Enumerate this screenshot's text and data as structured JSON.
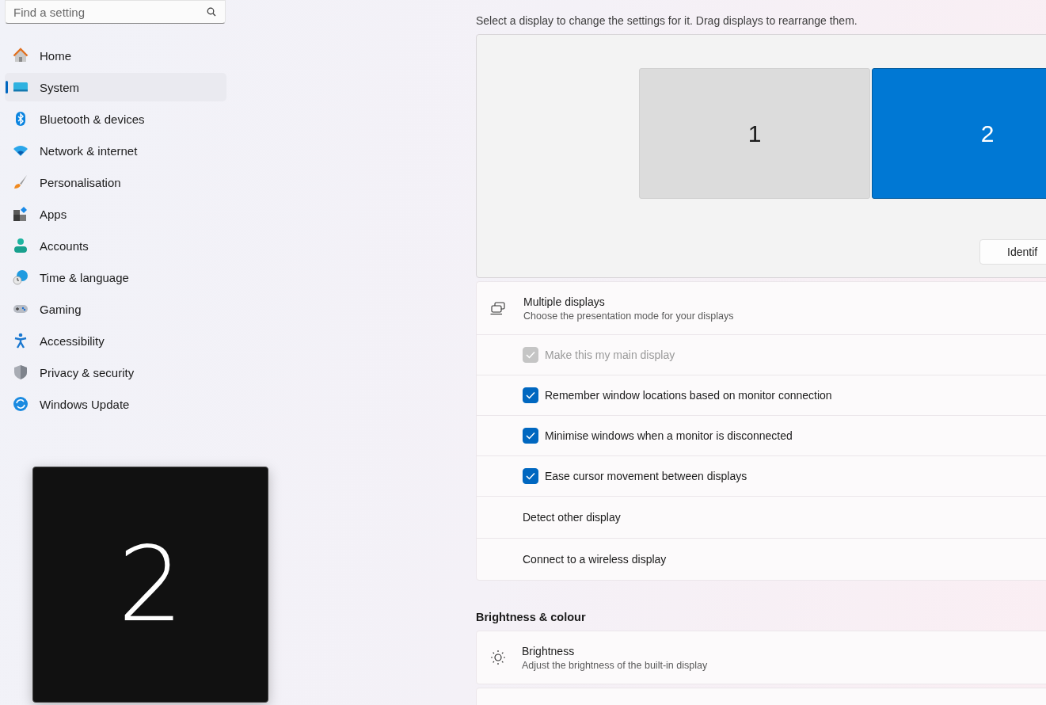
{
  "search": {
    "placeholder": "Find a setting"
  },
  "sidebar": {
    "items": [
      {
        "label": "Home",
        "selected": false
      },
      {
        "label": "System",
        "selected": true
      },
      {
        "label": "Bluetooth & devices",
        "selected": false
      },
      {
        "label": "Network & internet",
        "selected": false
      },
      {
        "label": "Personalisation",
        "selected": false
      },
      {
        "label": "Apps",
        "selected": false
      },
      {
        "label": "Accounts",
        "selected": false
      },
      {
        "label": "Time & language",
        "selected": false
      },
      {
        "label": "Gaming",
        "selected": false
      },
      {
        "label": "Accessibility",
        "selected": false
      },
      {
        "label": "Privacy & security",
        "selected": false
      },
      {
        "label": "Windows Update",
        "selected": false
      }
    ]
  },
  "display_arrangement": {
    "instruction": "Select a display to change the settings for it. Drag displays to rearrange them.",
    "monitors": [
      {
        "label": "1",
        "selected": false
      },
      {
        "label": "2",
        "selected": true
      }
    ],
    "identify_button": "Identif"
  },
  "multiple_displays": {
    "title": "Multiple displays",
    "description": "Choose the presentation mode for your displays",
    "options": [
      {
        "kind": "checkbox",
        "label": "Make this my main display",
        "checked": true,
        "disabled": true
      },
      {
        "kind": "checkbox",
        "label": "Remember window locations based on monitor connection",
        "checked": true,
        "disabled": false
      },
      {
        "kind": "checkbox",
        "label": "Minimise windows when a monitor is disconnected",
        "checked": true,
        "disabled": false
      },
      {
        "kind": "checkbox",
        "label": "Ease cursor movement between displays",
        "checked": true,
        "disabled": false
      },
      {
        "kind": "link",
        "label": "Detect other display"
      },
      {
        "kind": "link",
        "label": "Connect to a wireless display"
      }
    ]
  },
  "brightness_section": {
    "heading": "Brightness & colour",
    "items": [
      {
        "title": "Brightness",
        "description": "Adjust the brightness of the built-in display"
      }
    ]
  },
  "identify_overlay": {
    "label": "2"
  }
}
